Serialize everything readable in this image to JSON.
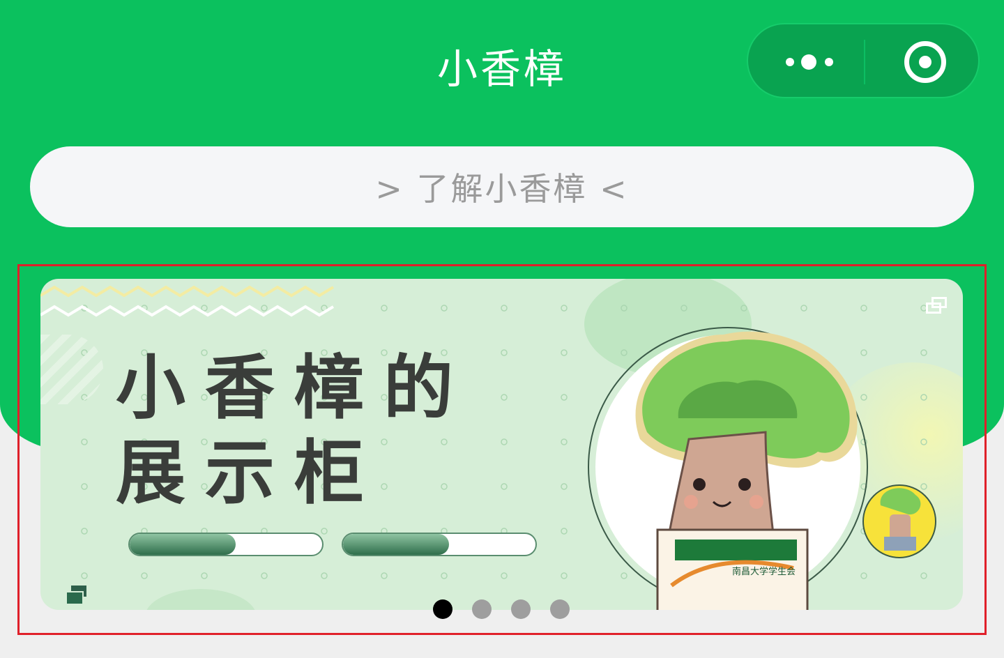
{
  "navbar": {
    "title": "小香樟",
    "more_icon": "more-dots-icon",
    "close_icon": "target-circle-icon"
  },
  "search": {
    "label": "> 了解小香樟 <"
  },
  "banner": {
    "title_line1": "小香樟的",
    "title_line2": "展示柜",
    "progress_bars": [
      {
        "fill_fraction": 0.55
      },
      {
        "fill_fraction": 0.55
      }
    ],
    "badge_text": "南昌大学学生会"
  },
  "pager": {
    "count": 4,
    "active_index": 0
  },
  "colors": {
    "brand_green": "#0bc15e",
    "banner_bg": "#d6eed7",
    "focus_outline": "#e0202a"
  }
}
